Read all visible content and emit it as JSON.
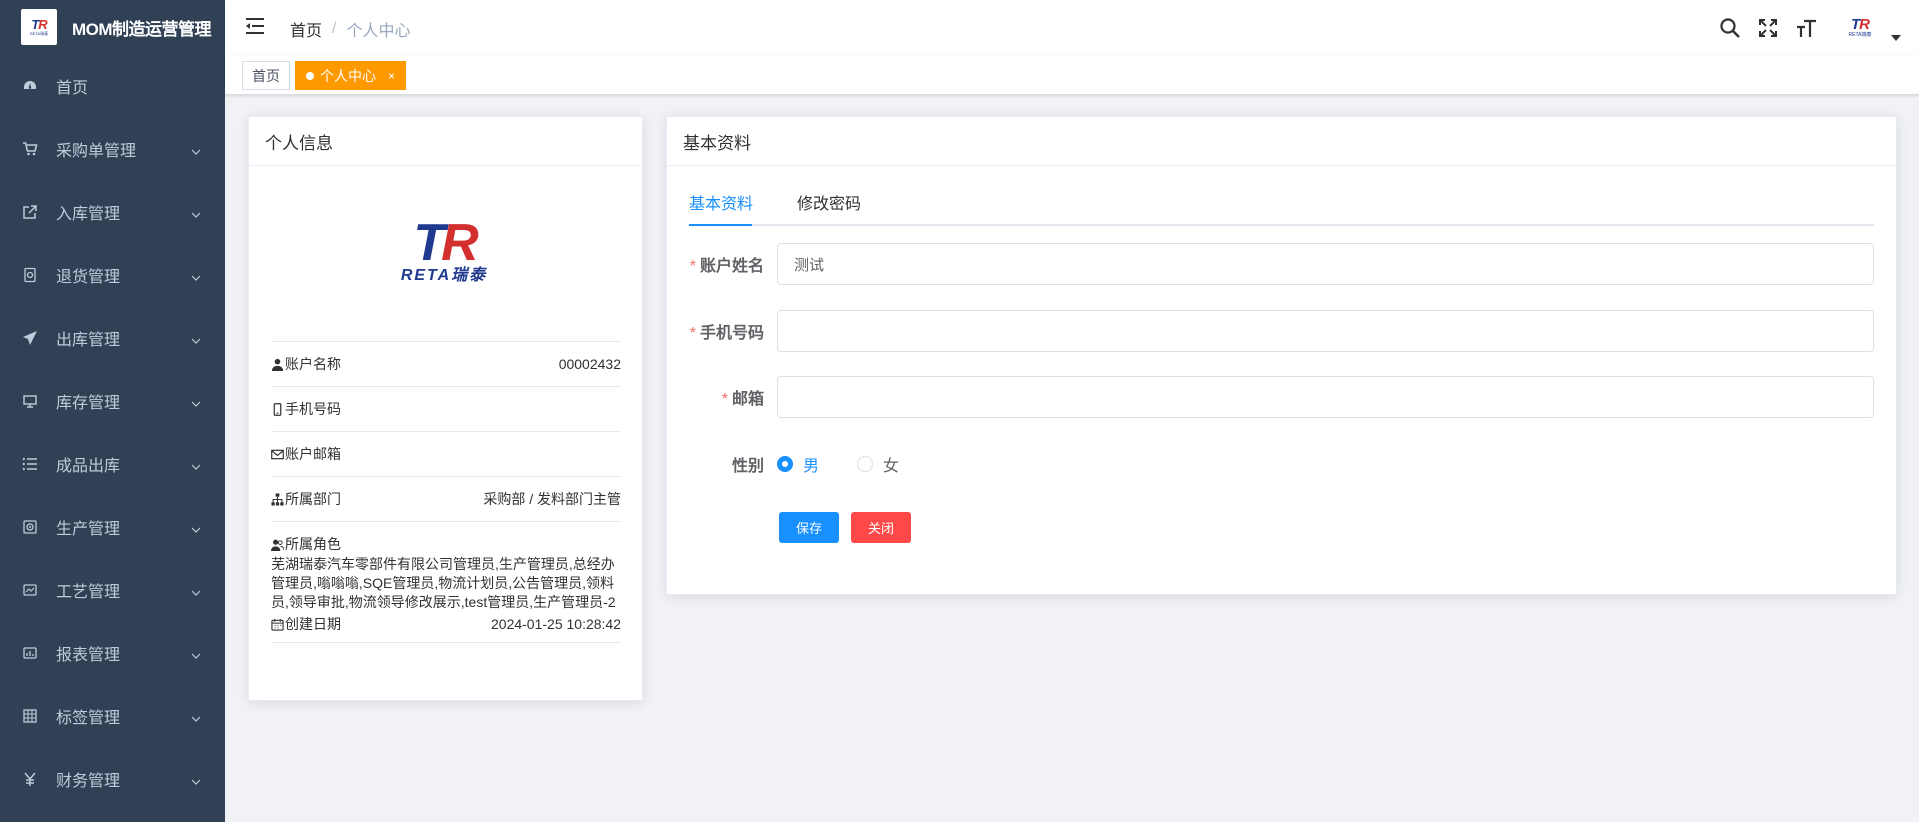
{
  "app": {
    "title": "MOM制造运营管理",
    "logo_text": "TR",
    "logo_sub": "RETA瑞泰"
  },
  "sidebar": {
    "items": [
      {
        "label": "首页",
        "icon": "dashboard-icon",
        "expandable": false
      },
      {
        "label": "采购单管理",
        "icon": "shopping-cart-icon",
        "expandable": true
      },
      {
        "label": "入库管理",
        "icon": "external-link-icon",
        "expandable": true
      },
      {
        "label": "退货管理",
        "icon": "return-icon",
        "expandable": true
      },
      {
        "label": "出库管理",
        "icon": "send-icon",
        "expandable": true
      },
      {
        "label": "库存管理",
        "icon": "monitor-icon",
        "expandable": true
      },
      {
        "label": "成品出库",
        "icon": "list-icon",
        "expandable": true
      },
      {
        "label": "生产管理",
        "icon": "production-icon",
        "expandable": true
      },
      {
        "label": "工艺管理",
        "icon": "process-icon",
        "expandable": true
      },
      {
        "label": "报表管理",
        "icon": "report-icon",
        "expandable": true
      },
      {
        "label": "标签管理",
        "icon": "grid-icon",
        "expandable": true
      },
      {
        "label": "财务管理",
        "icon": "yen-icon",
        "expandable": true
      }
    ]
  },
  "navbar": {
    "breadcrumb": [
      "首页",
      "个人中心"
    ],
    "breadcrumb_sep": "/",
    "icons": [
      "search-icon",
      "fullscreen-icon",
      "font-size-icon"
    ]
  },
  "tags": {
    "home": "首页",
    "active": "个人中心",
    "close": "×"
  },
  "profile": {
    "card_title": "个人信息",
    "logo_text": "TR",
    "logo_sub": "RETA瑞泰",
    "rows": {
      "account_name_label": "账户名称",
      "account_name_value": "00002432",
      "phone_label": "手机号码",
      "phone_value": "",
      "email_label": "账户邮箱",
      "email_value": "",
      "dept_label": "所属部门",
      "dept_value": "采购部 / 发料部门主管",
      "role_label": "所属角色",
      "role_value": "芜湖瑞泰汽车零部件有限公司管理员,生产管理员,总经办管理员,嗡嗡嗡,SQE管理员,物流计划员,公告管理员,领料员,领导审批,物流领导修改展示,test管理员,生产管理员-2",
      "created_label": "创建日期",
      "created_value": "2024-01-25 10:28:42"
    }
  },
  "form": {
    "card_title": "基本资料",
    "tabs": [
      "基本资料",
      "修改密码"
    ],
    "required_mark": "*",
    "name_label": "账户姓名",
    "name_value": "测试",
    "phone_label": "手机号码",
    "phone_value": "",
    "email_label": "邮箱",
    "email_value": "",
    "gender_label": "性别",
    "gender_options": [
      "男",
      "女"
    ],
    "gender_selected": "男",
    "save_label": "保存",
    "close_label": "关闭"
  },
  "colors": {
    "sidebar_bg": "#304156",
    "primary": "#1890ff",
    "danger": "#ff4949",
    "tag_active": "#ff9900",
    "required": "#f56c6c"
  }
}
